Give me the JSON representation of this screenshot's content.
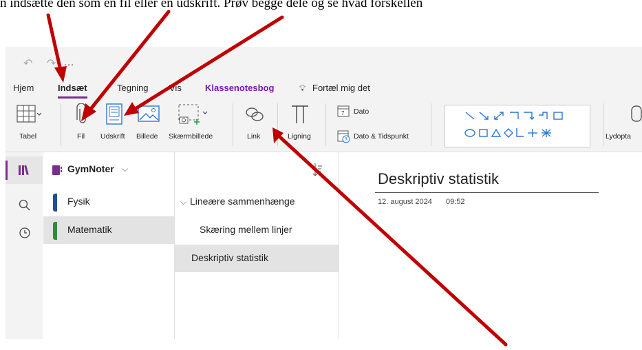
{
  "caption": "n indsætte den som en fil eller en udskrift. Prøv begge dele og se hvad forskellen",
  "tabs": [
    "Hjem",
    "Indsæt",
    "Tegning",
    "Vis",
    "Klassenotesbog",
    "Fortæl mig det"
  ],
  "ribbon": {
    "tabel": "Tabel",
    "fil": "Fil",
    "udskrift": "Udskrift",
    "billede": "Billede",
    "skaermbillede": "Skærmbillede",
    "link": "Link",
    "ligning": "Ligning",
    "dato": "Dato",
    "dato_tid": "Dato & Tidspunkt",
    "lydoptagelse": "Lydopta"
  },
  "notebook": {
    "name": "GymNoter"
  },
  "sections": [
    {
      "label": "Fysik",
      "color": "#1f4e9d"
    },
    {
      "label": "Matematik",
      "color": "#2e8b3a"
    }
  ],
  "pages": {
    "group": "Lineære sammenhænge",
    "items": [
      "Skæring mellem linjer",
      "Deskriptiv statistik"
    ]
  },
  "note": {
    "title": "Deskriptiv statistik",
    "date": "12. august 2024",
    "time": "09:52"
  },
  "colors": {
    "accent": "#7a2d8f",
    "klasse": "#7719aa",
    "arrow": "#c00000",
    "shape_blue": "#2a76cf"
  }
}
